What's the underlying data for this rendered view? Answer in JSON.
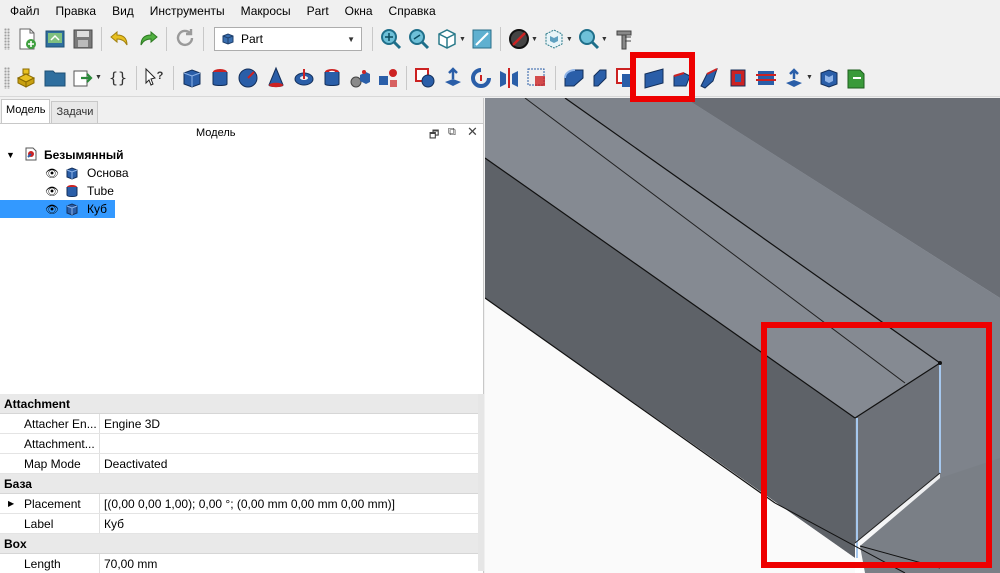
{
  "menu": [
    "Файл",
    "Правка",
    "Вид",
    "Инструменты",
    "Макросы",
    "Part",
    "Окна",
    "Справка"
  ],
  "workbench": {
    "selected": "Part"
  },
  "tabs": {
    "model": "Модель",
    "tasks": "Задачи"
  },
  "panel": {
    "title": "Модель"
  },
  "tree": {
    "root": "Безымянный",
    "items": [
      "Основа",
      "Tube",
      "Куб"
    ],
    "selected_index": 2
  },
  "properties": {
    "groups": [
      {
        "name": "Attachment",
        "rows": [
          {
            "name": "Attacher En...",
            "value": "Engine 3D"
          },
          {
            "name": "Attachment...",
            "value": ""
          },
          {
            "name": "Map Mode",
            "value": "Deactivated"
          }
        ]
      },
      {
        "name": "База",
        "rows": [
          {
            "name": "Placement",
            "value": "[(0,00 0,00 1,00); 0,00 °; (0,00 mm  0,00 mm  0,00 mm)]",
            "expandable": true
          },
          {
            "name": "Label",
            "value": "Куб"
          }
        ]
      },
      {
        "name": "Box",
        "rows": [
          {
            "name": "Length",
            "value": "70,00 mm"
          }
        ]
      }
    ]
  },
  "colors": {
    "highlight": "#ee0000",
    "selection": "#3399ff",
    "part_blue": "#3a6fb0",
    "part_red": "#cc2222"
  },
  "icons": {
    "toolbar1": [
      "new-document-icon",
      "open-icon",
      "save-icon",
      "undo-icon",
      "redo-icon",
      "refresh-icon",
      "part-box-icon",
      "fit-all-icon",
      "fit-selection-icon",
      "axonometric-view-icon",
      "sketch-view-icon",
      "draw-style-icon",
      "bounding-box-icon",
      "zoom-icon",
      "measure-icon"
    ],
    "toolbar2": [
      "part-design-icon",
      "folder-icon",
      "link-icon",
      "variable-set-icon",
      "whats-this-icon",
      "cube-icon",
      "cylinder-icon",
      "sphere-icon",
      "cone-icon",
      "torus-icon",
      "tube-icon",
      "primitives-icon",
      "shape-builder-icon",
      "boolean-icon",
      "extrude-icon",
      "revolve-icon",
      "mirror-icon",
      "section-icon",
      "fillet-icon",
      "chamfer-icon",
      "make-face-icon",
      "ruled-surface-icon",
      "loft-icon",
      "sweep-icon",
      "section-cross-icon",
      "cross-sections-icon",
      "offset-icon",
      "thickness-icon",
      "projection-icon"
    ]
  }
}
